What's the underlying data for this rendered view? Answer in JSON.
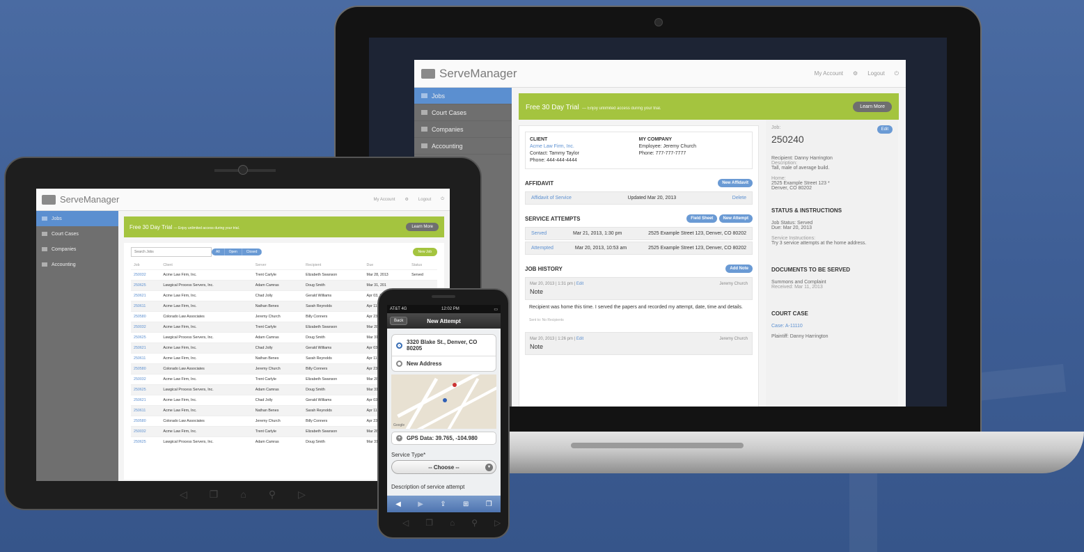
{
  "laptop": {
    "logo": "ServeManager",
    "my_account": "My Account",
    "logout": "Logout",
    "sidebar": [
      "Jobs",
      "Court Cases",
      "Companies",
      "Accounting"
    ],
    "banner": {
      "title": "Free 30 Day Trial",
      "sub": "—  Enjoy unlimited access during your trial.",
      "button": "Learn More"
    },
    "client": {
      "heading": "CLIENT",
      "name": "Acme Law Firm, Inc.",
      "contact": "Contact: Tammy Taylor",
      "phone": "Phone: 444-444-4444"
    },
    "company": {
      "heading": "MY COMPANY",
      "employee": "Employee: Jeremy Church",
      "phone": "Phone: 777-777-7777"
    },
    "affidavit": {
      "heading": "AFFIDAVIT",
      "button": "New Affidavit",
      "row_link": "Affidavit of Service",
      "row_date": "Updated Mar 20, 2013",
      "row_action": "Delete"
    },
    "attempts": {
      "heading": "SERVICE ATTEMPTS",
      "btn1": "Field Sheet",
      "btn2": "New Attempt",
      "rows": [
        {
          "status": "Served",
          "date": "Mar 21, 2013, 1:30 pm",
          "addr": "2525 Example Street 123, Denver, CO 80202"
        },
        {
          "status": "Attempted",
          "date": "Mar 20, 2013, 10:53 am",
          "addr": "2525 Example Street 123, Denver, CO 80202"
        }
      ]
    },
    "history": {
      "heading": "JOB HISTORY",
      "button": "Add Note",
      "note1": {
        "date": "Mar 20, 2013",
        "time": "1:31 pm",
        "edit": "Edit",
        "author": "Jeremy Church",
        "title": "Note",
        "body": "Recipient was home this time. I served the papers and recorded my attempt, date, time and details.",
        "sent": "Sent to: No Recipients"
      },
      "note2": {
        "date": "Mar 20, 2013",
        "time": "1:26 pm",
        "edit": "Edit",
        "author": "Jeremy Church",
        "title": "Note"
      }
    },
    "right": {
      "edit": "Edit",
      "job_label": "Job:",
      "job_no": "250240",
      "recipient": "Recipient: Danny Harrington",
      "desc_label": "Description:",
      "desc": "Tall, male of average build.",
      "home_label": "Home:",
      "home1": "2525 Example Street 123 *",
      "home2": "Denver, CO 80202",
      "status_h": "STATUS & INSTRUCTIONS",
      "job_status": "Job Status: Served",
      "due": "Due: Mar 20, 2013",
      "instr_label": "Service Instructions:",
      "instr": "Try 3 service attempts at the home address.",
      "docs_h": "DOCUMENTS TO BE SERVED",
      "docs": "Summons and Complaint",
      "received": "Received: Mar 11, 2013",
      "court_h": "COURT CASE",
      "case": "Case: A-11110",
      "plaintiff": "Plaintiff: Danny Harrington"
    }
  },
  "tablet": {
    "logo": "ServeManager",
    "my_account": "My Account",
    "logout": "Logout",
    "sidebar": [
      "Jobs",
      "Court Cases",
      "Companies",
      "Accounting"
    ],
    "banner": {
      "title": "Free 30 Day Trial",
      "sub": "—  Enjoy unlimited access during your trial.",
      "button": "Learn More"
    },
    "search_placeholder": "Search Jobs",
    "filters": [
      "All",
      "Open",
      "Closed"
    ],
    "new_job": "New Job",
    "columns": [
      "Job",
      "Client",
      "Server",
      "Recipient",
      "Due",
      "Status"
    ],
    "rows": [
      [
        "250032",
        "Acme Law Firm, Inc.",
        "Trent Carlyle",
        "Elizabeth Swanson",
        "Mar 28, 2013",
        "Served"
      ],
      [
        "250625",
        "Lawgical Process Servers, Inc.",
        "Adam Camras",
        "Doug Smith",
        "Mar 31, 201",
        ""
      ],
      [
        "250621",
        "Acme Law Firm, Inc.",
        "Chad Jolly",
        "Gerald Williams",
        "Apr 03, 201",
        ""
      ],
      [
        "250611",
        "Acme Law Firm, Inc.",
        "Nathan Benes",
        "Sarah Reynolds",
        "Apr 11, 201",
        ""
      ],
      [
        "250580",
        "Colorado Law Associates",
        "Jeremy Church",
        "Billy Conners",
        "Apr 23, 201",
        ""
      ],
      [
        "250032",
        "Acme Law Firm, Inc.",
        "Trent Carlyle",
        "Elizabeth Swanson",
        "Mar 28, 201",
        ""
      ],
      [
        "250625",
        "Lawgical Process Servers, Inc.",
        "Adam Camras",
        "Doug Smith",
        "Mar 31, 201",
        ""
      ],
      [
        "250621",
        "Acme Law Firm, Inc.",
        "Chad Jolly",
        "Gerald Williams",
        "Apr 03, 201",
        ""
      ],
      [
        "250611",
        "Acme Law Firm, Inc.",
        "Nathan Benes",
        "Sarah Reynolds",
        "Apr 11, 201",
        ""
      ],
      [
        "250580",
        "Colorado Law Associates",
        "Jeremy Church",
        "Billy Conners",
        "Apr 23, 201",
        ""
      ],
      [
        "250032",
        "Acme Law Firm, Inc.",
        "Trent Carlyle",
        "Elizabeth Swanson",
        "Mar 28, 201",
        ""
      ],
      [
        "250625",
        "Lawgical Process Servers, Inc.",
        "Adam Camras",
        "Doug Smith",
        "Mar 31, 201",
        ""
      ],
      [
        "250621",
        "Acme Law Firm, Inc.",
        "Chad Jolly",
        "Gerald Williams",
        "Apr 03, 201",
        ""
      ],
      [
        "250611",
        "Acme Law Firm, Inc.",
        "Nathan Benes",
        "Sarah Reynolds",
        "Apr 11, 201",
        ""
      ],
      [
        "250580",
        "Colorado Law Associates",
        "Jeremy Church",
        "Billy Conners",
        "Apr 23, 201",
        ""
      ],
      [
        "250032",
        "Acme Law Firm, Inc.",
        "Trent Carlyle",
        "Elizabeth Swanson",
        "Mar 28, 201",
        ""
      ],
      [
        "250625",
        "Lawgical Process Servers, Inc.",
        "Adam Camras",
        "Doug Smith",
        "Mar 31, 201",
        ""
      ]
    ]
  },
  "phone": {
    "carrier": "AT&T 4G",
    "time": "12:02 PM",
    "back": "Back",
    "title": "New Attempt",
    "addr1": "3320 Blake St., Denver, CO 80205",
    "addr2": "New Address",
    "gps": "GPS Data: 39.765, -104.980",
    "service_type_label": "Service Type*",
    "select_value": "-- Choose --",
    "desc_label": "Description of service attempt",
    "map_credit": "Google"
  },
  "colors": {
    "accent_blue": "#5b8fd0",
    "trial_green": "#a4c43f",
    "sidebar_grey": "#6f6f6f",
    "background": "#3e5d93"
  }
}
